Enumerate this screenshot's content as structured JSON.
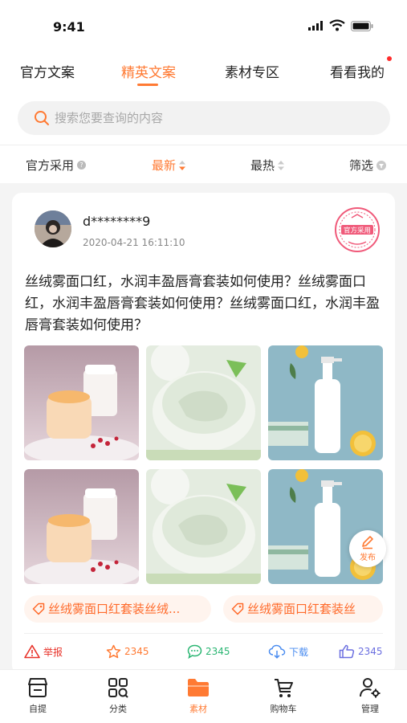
{
  "status_bar": {
    "time": "9:41"
  },
  "top_tabs": [
    {
      "label": "官方文案",
      "active": false
    },
    {
      "label": "精英文案",
      "active": true
    },
    {
      "label": "素材专区",
      "active": false
    },
    {
      "label": "看看我的",
      "active": false
    }
  ],
  "search": {
    "placeholder": "搜索您要查询的内容"
  },
  "filters": [
    {
      "label": "官方采用",
      "active": false
    },
    {
      "label": "最新",
      "active": true
    },
    {
      "label": "最热",
      "active": false
    },
    {
      "label": "筛选",
      "active": false
    }
  ],
  "post": {
    "username": "d********9",
    "time": "2020-04-21 16:11:10",
    "badge_text": "官方采用",
    "text": "丝绒雾面口红，水润丰盈唇膏套装如何使用？丝绒雾面口红，水润丰盈唇膏套装如何使用？丝绒雾面口红，水润丰盈唇膏套装如何使用？",
    "images": [
      "jar-cream",
      "gel-jar",
      "pump-bottle",
      "jar-cream",
      "gel-jar",
      "pump-bottle"
    ],
    "tags": [
      "丝绒雾面口红套装丝绒...",
      "丝绒雾面口红套装丝"
    ],
    "actions": {
      "report": "举报",
      "star": "2345",
      "comment": "2345",
      "download": "下载",
      "like": "2345"
    }
  },
  "fab": {
    "label": "发布"
  },
  "tab_bar": [
    {
      "label": "自提",
      "icon": "store-icon",
      "active": false
    },
    {
      "label": "分类",
      "icon": "category-icon",
      "active": false
    },
    {
      "label": "素材",
      "icon": "folder-icon",
      "active": true
    },
    {
      "label": "购物车",
      "icon": "cart-icon",
      "active": false
    },
    {
      "label": "管理",
      "icon": "user-settings-icon",
      "active": false
    }
  ],
  "colors": {
    "accent": "#ff7a33",
    "tag_bg": "#fff4ee",
    "comment": "#2bb673",
    "download": "#4a8cf0",
    "like": "#6b6fe0",
    "report": "#e8332a"
  }
}
